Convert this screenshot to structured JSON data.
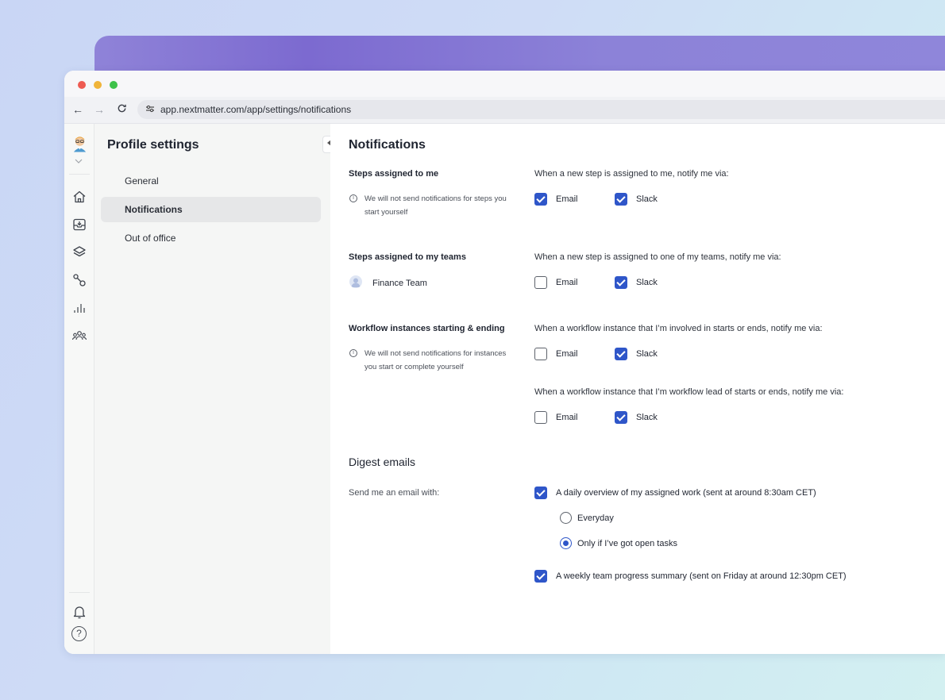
{
  "browser": {
    "url": "app.nextmatter.com/app/settings/notifications"
  },
  "rail": {
    "icons": [
      "avatar",
      "chevron-down-icon",
      "home-icon",
      "inbox-icon",
      "layers-icon",
      "workflow-icon",
      "analytics-icon",
      "teams-icon",
      "bell-icon",
      "help-icon"
    ],
    "help_glyph": "?"
  },
  "sidebar": {
    "title": "Profile settings",
    "items": [
      {
        "label": "General",
        "active": false
      },
      {
        "label": "Notifications",
        "active": true
      },
      {
        "label": "Out of office",
        "active": false
      }
    ]
  },
  "main": {
    "title": "Notifications",
    "sections": [
      {
        "label": "Steps assigned to me",
        "note": "We will not send notifications for steps you start yourself",
        "rows": [
          {
            "prompt": "When a new step is assigned to me, notify me via:",
            "email": true,
            "slack": true
          }
        ]
      },
      {
        "label": "Steps assigned to my teams",
        "team": "Finance Team",
        "rows": [
          {
            "prompt": "When a new step is assigned to one of my teams, notify me via:",
            "email": false,
            "slack": true
          }
        ]
      },
      {
        "label": "Workflow instances starting & ending",
        "note": "We will not send notifications for instances you start or complete yourself",
        "rows": [
          {
            "prompt": "When a workflow instance that I’m involved in starts or ends, notify me via:",
            "email": false,
            "slack": true
          },
          {
            "prompt": "When a workflow instance that I’m workflow lead of starts or ends, notify me via:",
            "email": false,
            "slack": true
          }
        ]
      }
    ],
    "channel_labels": {
      "email": "Email",
      "slack": "Slack"
    },
    "digest": {
      "title": "Digest emails",
      "label": "Send me an email with:",
      "daily": {
        "label": "A daily overview of my assigned work (sent at around 8:30am CET)",
        "checked": true
      },
      "frequency_options": [
        {
          "label": "Everyday",
          "selected": false
        },
        {
          "label": "Only if I’ve got open tasks",
          "selected": true
        }
      ],
      "weekly": {
        "label": "A weekly team progress summary (sent on Friday at around 12:30pm CET)",
        "checked": true
      }
    }
  },
  "colors": {
    "accent": "#2f56c9",
    "sidebar_bg": "#f5f6f5",
    "active_item_bg": "#e6e7e8"
  }
}
